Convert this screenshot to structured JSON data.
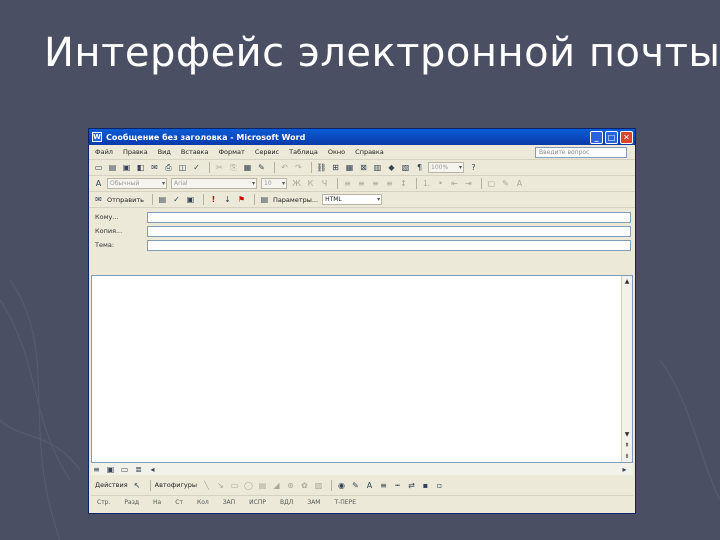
{
  "slide": {
    "title": "Интерфейс электронной почты"
  },
  "window": {
    "title": "Сообщение без заголовка - Microsoft Word",
    "minimize": "_",
    "maximize": "□",
    "close": "✕"
  },
  "menu": {
    "items": [
      "Файл",
      "Правка",
      "Вид",
      "Вставка",
      "Формат",
      "Сервис",
      "Таблица",
      "Окно",
      "Справка"
    ],
    "help_placeholder": "Введите вопрос"
  },
  "toolbar_format": {
    "style": "Обычный",
    "font": "Arial",
    "size": "10",
    "zoom": "100%"
  },
  "toolbar_mail": {
    "send_label": "Отправить",
    "options_label": "Параметры...",
    "format_value": "HTML"
  },
  "headers": {
    "to_label": "Кому...",
    "cc_label": "Копия...",
    "subject_label": "Тема:"
  },
  "drawbar": {
    "actions_label": "Действия",
    "autoshapes_label": "Автофигуры"
  },
  "statusbar": {
    "page": "Стр.",
    "section": "Разд",
    "position": "На",
    "line": "Ст",
    "col": "Кол",
    "rec": "ЗАП",
    "trk": "ИСПР",
    "ext": "ВДЛ",
    "ovr": "ЗАМ",
    "lang": "Т-ПЕРЕ"
  },
  "colors": {
    "slide_bg": "#4a4f63",
    "titlebar": "#0a3aa8",
    "window_bg": "#ece9d8"
  }
}
